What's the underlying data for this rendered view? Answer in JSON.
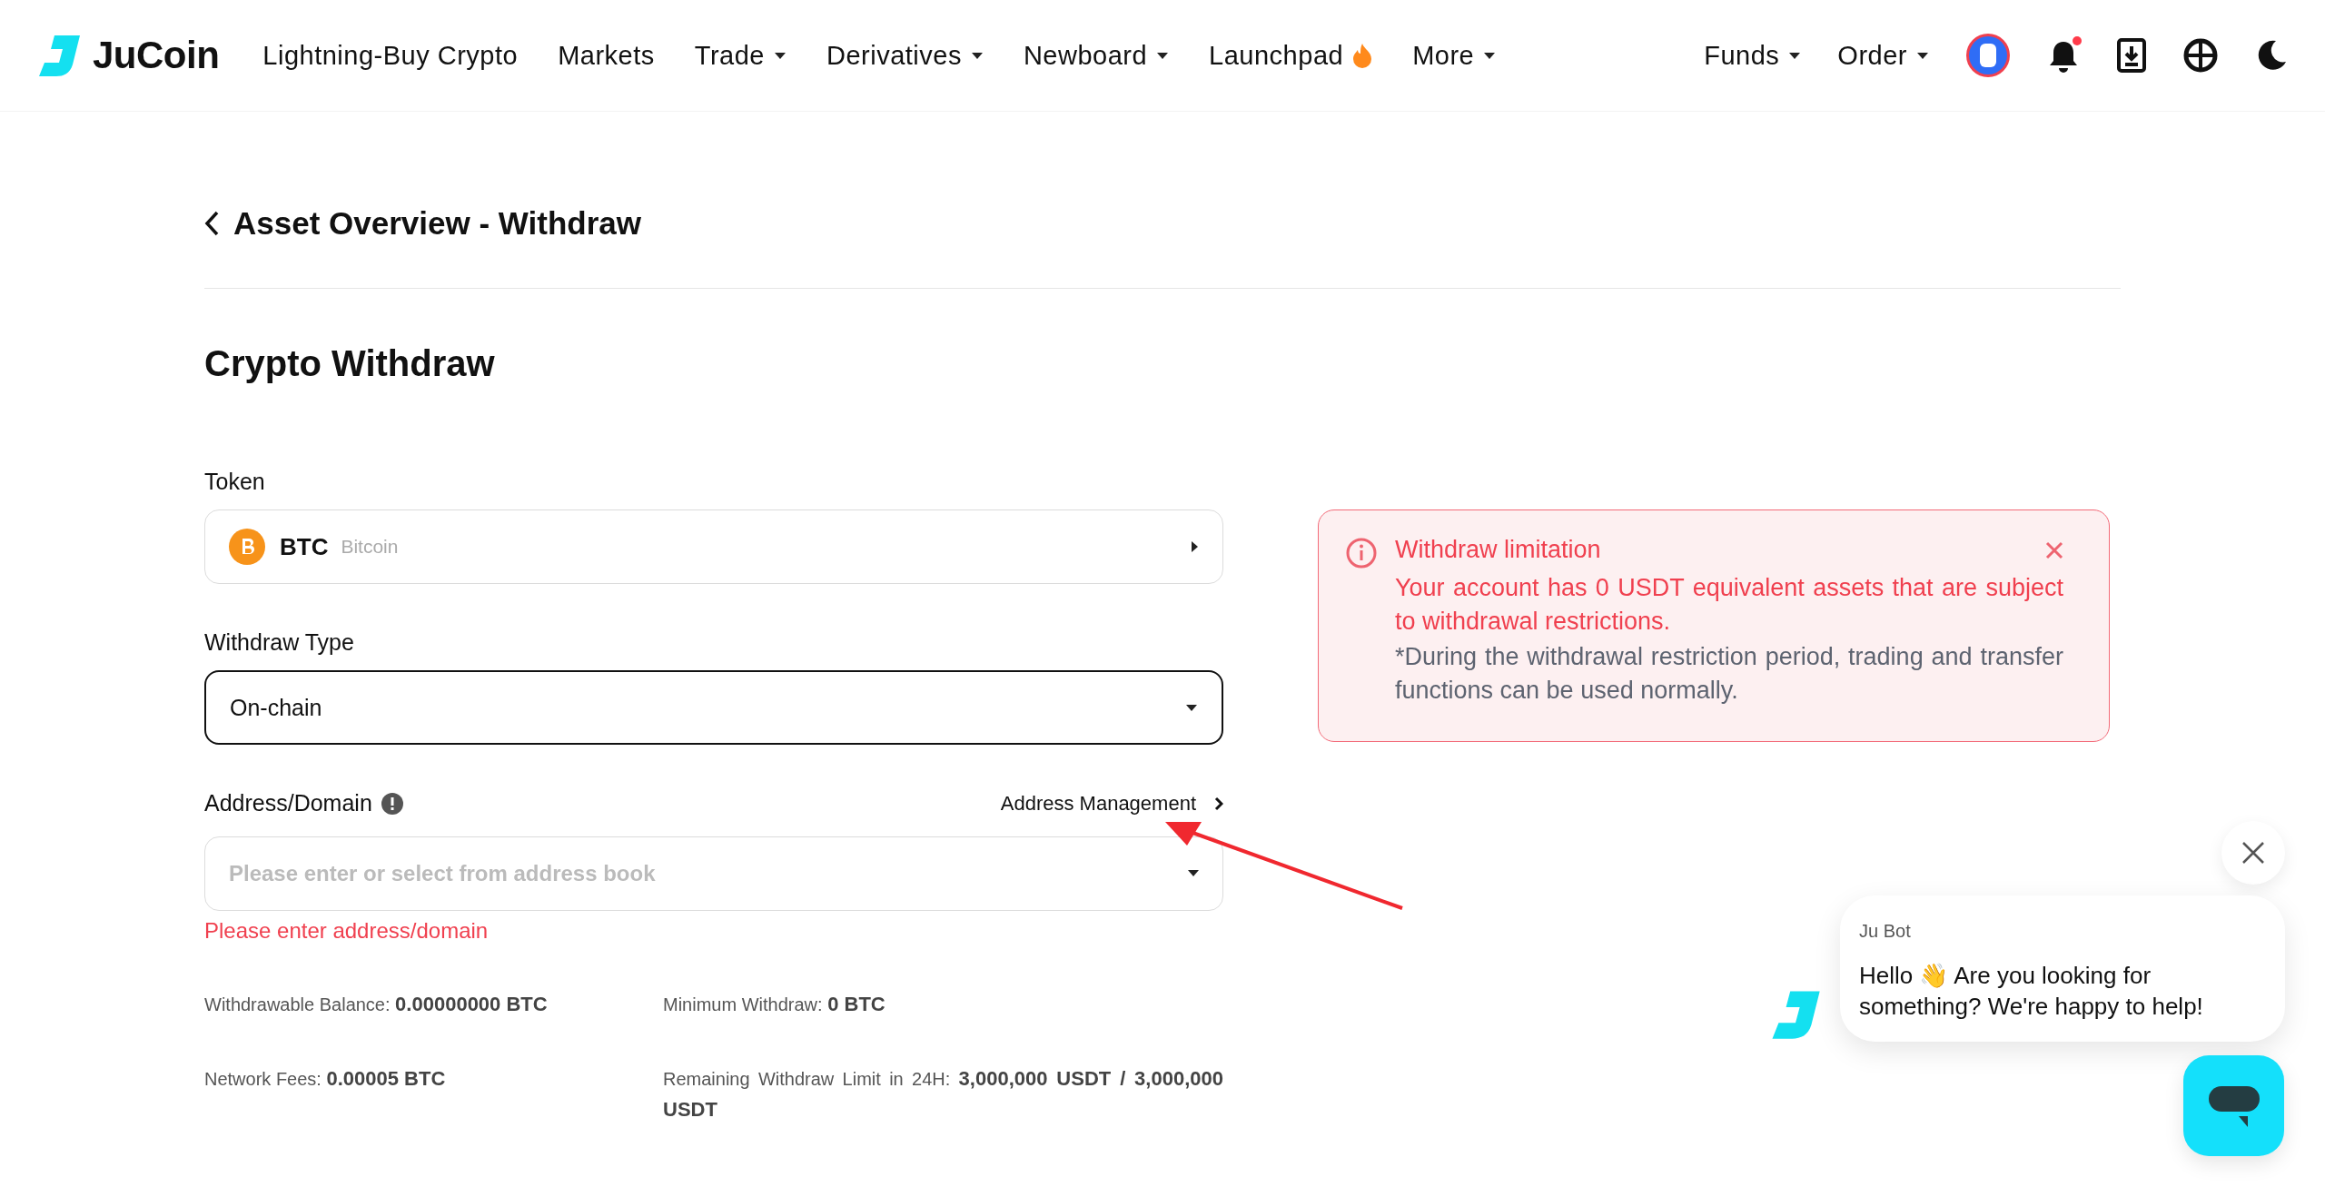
{
  "header": {
    "brand": "JuCoin",
    "nav": [
      {
        "label": "Lightning-Buy Crypto",
        "kind": "link"
      },
      {
        "label": "Markets",
        "kind": "link"
      },
      {
        "label": "Trade",
        "kind": "dropdown"
      },
      {
        "label": "Derivatives",
        "kind": "dropdown"
      },
      {
        "label": "Newboard",
        "kind": "dropdown"
      },
      {
        "label": "Launchpad",
        "kind": "hot"
      },
      {
        "label": "More",
        "kind": "dropdown"
      }
    ],
    "right_nav": [
      {
        "label": "Funds",
        "kind": "dropdown"
      },
      {
        "label": "Order",
        "kind": "dropdown"
      }
    ],
    "notifications_unread": true
  },
  "breadcrumb": "Asset Overview - Withdraw",
  "heading": "Crypto Withdraw",
  "form": {
    "token": {
      "label": "Token",
      "symbol": "BTC",
      "name": "Bitcoin"
    },
    "withdraw_type": {
      "label": "Withdraw Type",
      "value": "On-chain",
      "focused": true
    },
    "address": {
      "label": "Address/Domain",
      "link": "Address Management",
      "placeholder": "Please enter or select from address book",
      "error": "Please enter address/domain"
    },
    "stats": [
      {
        "text": "Withdrawable Balance: **0.00000000 BTC**"
      },
      {
        "text": "Minimum Withdraw: **0 BTC**"
      },
      {
        "text": "Network Fees: **0.00005 BTC**"
      },
      {
        "text": "Remaining Withdraw Limit in 24H: **3,000,000 USDT / 3,000,000 USDT**"
      }
    ]
  },
  "alert": {
    "title": "Withdraw limitation",
    "message": "Your account has 0 USDT equivalent assets that are subject to withdrawal restrictions.",
    "note": "*During the withdrawal restriction period, trading and transfer functions can be used normally."
  },
  "chat": {
    "sender": "Ju Bot",
    "message": "Hello 👋 Are you looking for something? We're happy to help!"
  }
}
